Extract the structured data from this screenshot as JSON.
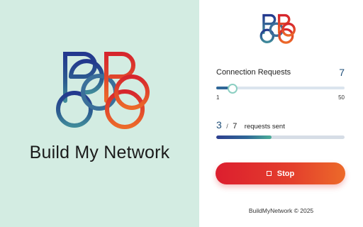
{
  "brand": {
    "name": "Build My Network"
  },
  "connection": {
    "label": "Connection Requests",
    "value": "7",
    "slider": {
      "min": 1,
      "max": 50,
      "current": 7,
      "min_label": "1",
      "max_label": "50"
    }
  },
  "progress": {
    "sent": "3",
    "separator": "/",
    "total": "7",
    "suffix": "requests sent",
    "fraction": 0.4286
  },
  "stop_button": {
    "label": "Stop"
  },
  "footer": {
    "text": "BuildMyNetwork © 2025"
  },
  "colors": {
    "left_panel_bg": "#d3ece2",
    "accent_blue": "#1f4f7a",
    "stop_gradient_start": "#dc1e2e",
    "stop_gradient_end": "#ec6a2a"
  },
  "icons": {
    "logo": "bbb-rings-logo-icon",
    "stop": "stop-square-icon"
  }
}
